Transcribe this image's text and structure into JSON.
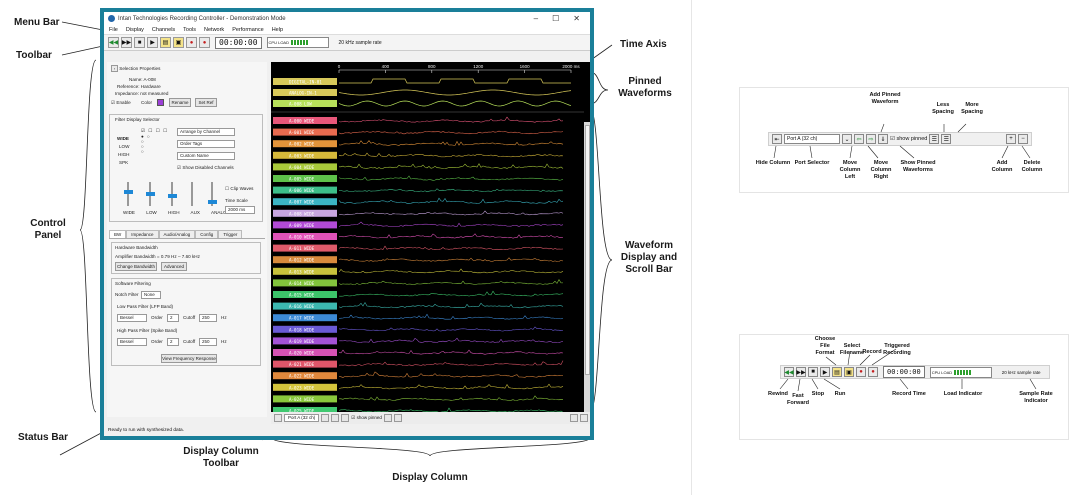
{
  "callouts": {
    "menu_bar": "Menu Bar",
    "toolbar": "Toolbar",
    "control_panel": "Control Panel",
    "status_bar": "Status Bar",
    "time_axis": "Time Axis",
    "pinned_waveforms": "Pinned Waveforms",
    "waveform_display": "Waveform Display and Scroll Bar",
    "display_column_toolbar": "Display Column Toolbar",
    "display_column": "Display Column"
  },
  "app": {
    "title": "Intan Technologies Recording Controller - Demonstration Mode",
    "window_buttons": [
      "–",
      "☐",
      "✕"
    ],
    "menu": [
      "File",
      "Display",
      "Channels",
      "Tools",
      "Network",
      "Performance",
      "Help"
    ],
    "time_display": "00:00:00",
    "load_text": "CPU LOAD",
    "sample_rate": "20 kHz sample rate",
    "status": "Ready to run with synthesized data.",
    "control_panel": {
      "selection_properties": "Selection Properties",
      "name": "Name:  A-008",
      "reference": "Reference:  Hardware",
      "impedance": "Impedance:  not measured",
      "enable": "Enable",
      "color": "Color",
      "rename": "Rename",
      "set_ref": "Set Ref",
      "filter_display_selector": "Filter Display Selector",
      "filters": [
        "WIDE",
        "LOW",
        "HIGH",
        "SPK"
      ],
      "arrange": "Arrange by Channel",
      "order": "Order Tags",
      "custom": "Custom Name",
      "show_disabled": "Show Disabled Channels",
      "sliders": [
        "WIDE",
        "LOW",
        "HIGH",
        "AUX",
        "ANALOG"
      ],
      "clip_waves": "Clip Waves",
      "time_scale": "Time Scale",
      "time_scale_value": "2000 ms",
      "tabs": [
        "BW",
        "Impedance",
        "Audio/Analog",
        "Config",
        "Trigger"
      ],
      "hw_bandwidth": "Hardware Bandwidth",
      "amp_bandwidth": "Amplifier Bandwidth = 0.79 Hz – 7.60 kHz",
      "change_bandwidth": "Change Bandwidth",
      "advanced": "Advanced",
      "software_filtering": "Software Filtering",
      "notch_filter": "Notch Filter",
      "notch_value": "None",
      "low_pass": "Low Pass Filter (LFP Band)",
      "high_pass": "High Pass Filter (Spike Band)",
      "bessel": "Bessel",
      "order_label": "Order",
      "order_value": "2",
      "cutoff": "Cutoff",
      "lp_cutoff": "250",
      "hp_cutoff": "250",
      "hz": "Hz",
      "view_freq": "View Frequency Response"
    },
    "axis_ticks": [
      "0",
      "400",
      "800",
      "1200",
      "1600",
      "2000 ms"
    ],
    "pinned": [
      {
        "label": "DIGITAL-IN-01",
        "color": "#d8c95a"
      },
      {
        "label": "ANALOG-IN-1",
        "color": "#d8c95a"
      },
      {
        "label": "A-008 LOW",
        "color": "#b7e05a"
      }
    ],
    "channels": [
      {
        "label": "A-000 WIDE",
        "color": "#e8577a"
      },
      {
        "label": "A-001 WIDE",
        "color": "#e86a4f"
      },
      {
        "label": "A-002 WIDE",
        "color": "#e3943a"
      },
      {
        "label": "A-003 WIDE",
        "color": "#d6b93a"
      },
      {
        "label": "A-004 WIDE",
        "color": "#a8c93a"
      },
      {
        "label": "A-005 WIDE",
        "color": "#5ec24a"
      },
      {
        "label": "A-006 WIDE",
        "color": "#3dbf8a"
      },
      {
        "label": "A-007 WIDE",
        "color": "#3bb5c4"
      },
      {
        "label": "A-008 WIDE",
        "color": "#c8a6e0"
      },
      {
        "label": "A-009 WIDE",
        "color": "#b24ad6"
      },
      {
        "label": "A-010 WIDE",
        "color": "#e052b8"
      },
      {
        "label": "A-011 WIDE",
        "color": "#e05a6a"
      },
      {
        "label": "A-012 WIDE",
        "color": "#d88a3c"
      },
      {
        "label": "A-013 WIDE",
        "color": "#c8c23c"
      },
      {
        "label": "A-014 WIDE",
        "color": "#82c43c"
      },
      {
        "label": "A-015 WIDE",
        "color": "#3cc46a"
      },
      {
        "label": "A-016 WIDE",
        "color": "#3cb8b0"
      },
      {
        "label": "A-017 WIDE",
        "color": "#3c8ad6"
      },
      {
        "label": "A-018 WIDE",
        "color": "#6a5ad6"
      },
      {
        "label": "A-019 WIDE",
        "color": "#a452d6"
      },
      {
        "label": "A-020 WIDE",
        "color": "#d652b4"
      },
      {
        "label": "A-021 WIDE",
        "color": "#e0566a"
      },
      {
        "label": "A-022 WIDE",
        "color": "#e0883c"
      },
      {
        "label": "A-023 WIDE",
        "color": "#d4c43c"
      },
      {
        "label": "A-024 WIDE",
        "color": "#8ac83c"
      },
      {
        "label": "A-025 WIDE",
        "color": "#40c870"
      }
    ],
    "column_toolbar": {
      "port": "Port A (32 ch)",
      "show_pinned": "show pinned"
    }
  },
  "inset_top": {
    "port": "Port A (32 ch)",
    "show_pinned": "show pinned",
    "labels": {
      "hide_column": "Hide Column",
      "port_selector": "Port Selector",
      "move_left": "Move Column Left",
      "move_right": "Move Column Right",
      "add_pinned": "Add Pinned Waveform",
      "show_pinned": "Show Pinned Waveforms",
      "less_spacing": "Less Spacing",
      "more_spacing": "More Spacing",
      "add_column": "Add Column",
      "delete_column": "Delete Column"
    }
  },
  "inset_bottom": {
    "time": "00:00:00",
    "sample_rate": "20 kHz sample rate",
    "load_text": "CPU LOAD",
    "labels": {
      "rewind": "Rewind",
      "fast_forward": "Fast Forward",
      "stop": "Stop",
      "run": "Run",
      "choose_format": "Choose File Format",
      "select_filename": "Select Filename",
      "record": "Record",
      "triggered": "Triggered Recording",
      "record_time": "Record Time",
      "load_indicator": "Load Indicator",
      "sample_rate_indicator": "Sample Rate Indicator"
    }
  }
}
